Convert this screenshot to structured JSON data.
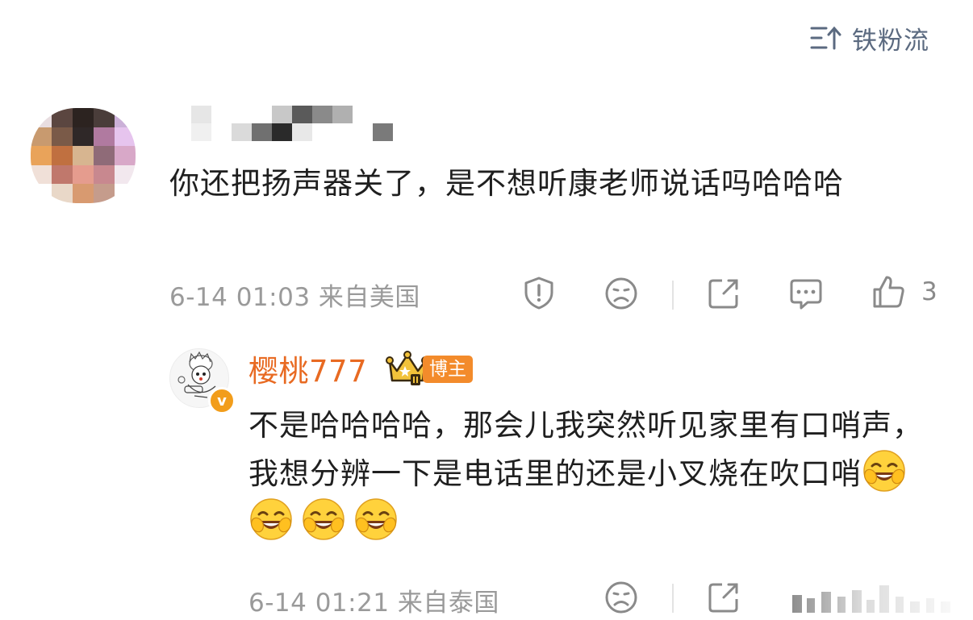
{
  "header": {
    "sort_label": "铁粉流",
    "sort_icon": "sort-icon"
  },
  "comments": [
    {
      "username": "",
      "text": "你还把扬声器关了，是不想听康老师说话吗哈哈哈",
      "meta": "6-14 01:03 来自美国",
      "like_count": "3",
      "avatar_colors": [
        "#e8dde0",
        "#5b4640",
        "#2c2320",
        "#4a3d3a",
        "#cbb0d8",
        "#c89a6f",
        "#7a5a48",
        "#2f2828",
        "#b07aa0",
        "#e6c4ee",
        "#e9a35a",
        "#c07040",
        "#d7b590",
        "#8f6b78",
        "#d8a8c8",
        "#f0e0d8",
        "#c0786c",
        "#e59c8e",
        "#c8888f",
        "#f2e8ee",
        "#ffffff",
        "#e9d8c8",
        "#d89a70",
        "#c59c8c",
        "#ffffff"
      ]
    }
  ],
  "reply": {
    "username": "樱桃777",
    "author_tag": "博主",
    "verified_label": "v",
    "text": "不是哈哈哈哈，那会儿我突然听见家里有口哨声，我想分辨一下是电话里的还是小叉烧在吹口哨",
    "emoji_count": 4,
    "meta": "6-14 01:21 来自泰国"
  },
  "icons": [
    "report-icon",
    "dislike-icon",
    "share-icon",
    "comment-icon",
    "like-icon"
  ],
  "colors": {
    "accent_orange": "#e86a22",
    "meta_gray": "#9a9a9a",
    "icon_gray": "#8a8a8a"
  }
}
